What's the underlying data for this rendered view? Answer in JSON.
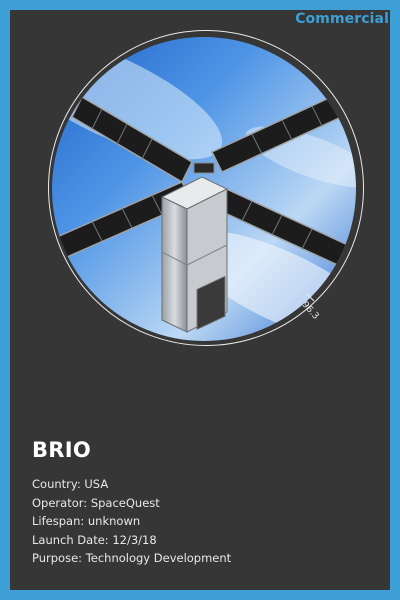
{
  "category": "Commercial",
  "satellite": {
    "name": "BRIO",
    "orbit_angle": "96.3"
  },
  "details": [
    {
      "label": "Country:",
      "value": "USA"
    },
    {
      "label": "Operator:",
      "value": "SpaceQuest"
    },
    {
      "label": "Lifespan:",
      "value": "unknown"
    },
    {
      "label": "Launch Date:",
      "value": "12/3/18"
    },
    {
      "label": "Purpose:",
      "value": "Technology Development"
    }
  ],
  "colors": {
    "accent": "#3d9fd6",
    "card": "#363636"
  }
}
